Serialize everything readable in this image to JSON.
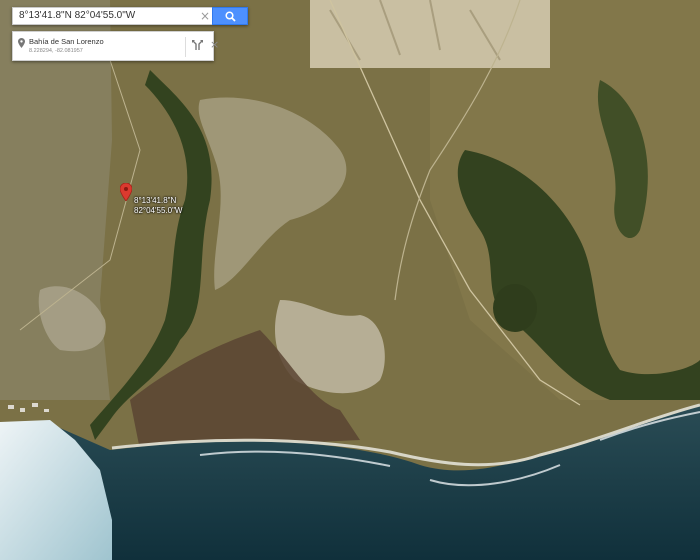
{
  "search": {
    "value": "8°13'41.8\"N 82°04'55.0\"W",
    "clear_icon": "×"
  },
  "info_card": {
    "title": "Bahía de San Lorenzo",
    "coords": "8.228294, -82.081957",
    "close_icon": "×"
  },
  "marker": {
    "label": "8°13'41.8\"N 82°04'55.0\"W"
  },
  "icons": {
    "search": "search-icon",
    "pin": "pin-icon",
    "directions": "directions-icon",
    "close": "close-icon",
    "marker": "map-marker-icon"
  },
  "colors": {
    "search_button": "#4d90fe",
    "marker": "#db3a2f",
    "ocean": "#1d3f48",
    "surf": "#e5eef2",
    "land": "#7a7044",
    "forest": "#33421f"
  }
}
